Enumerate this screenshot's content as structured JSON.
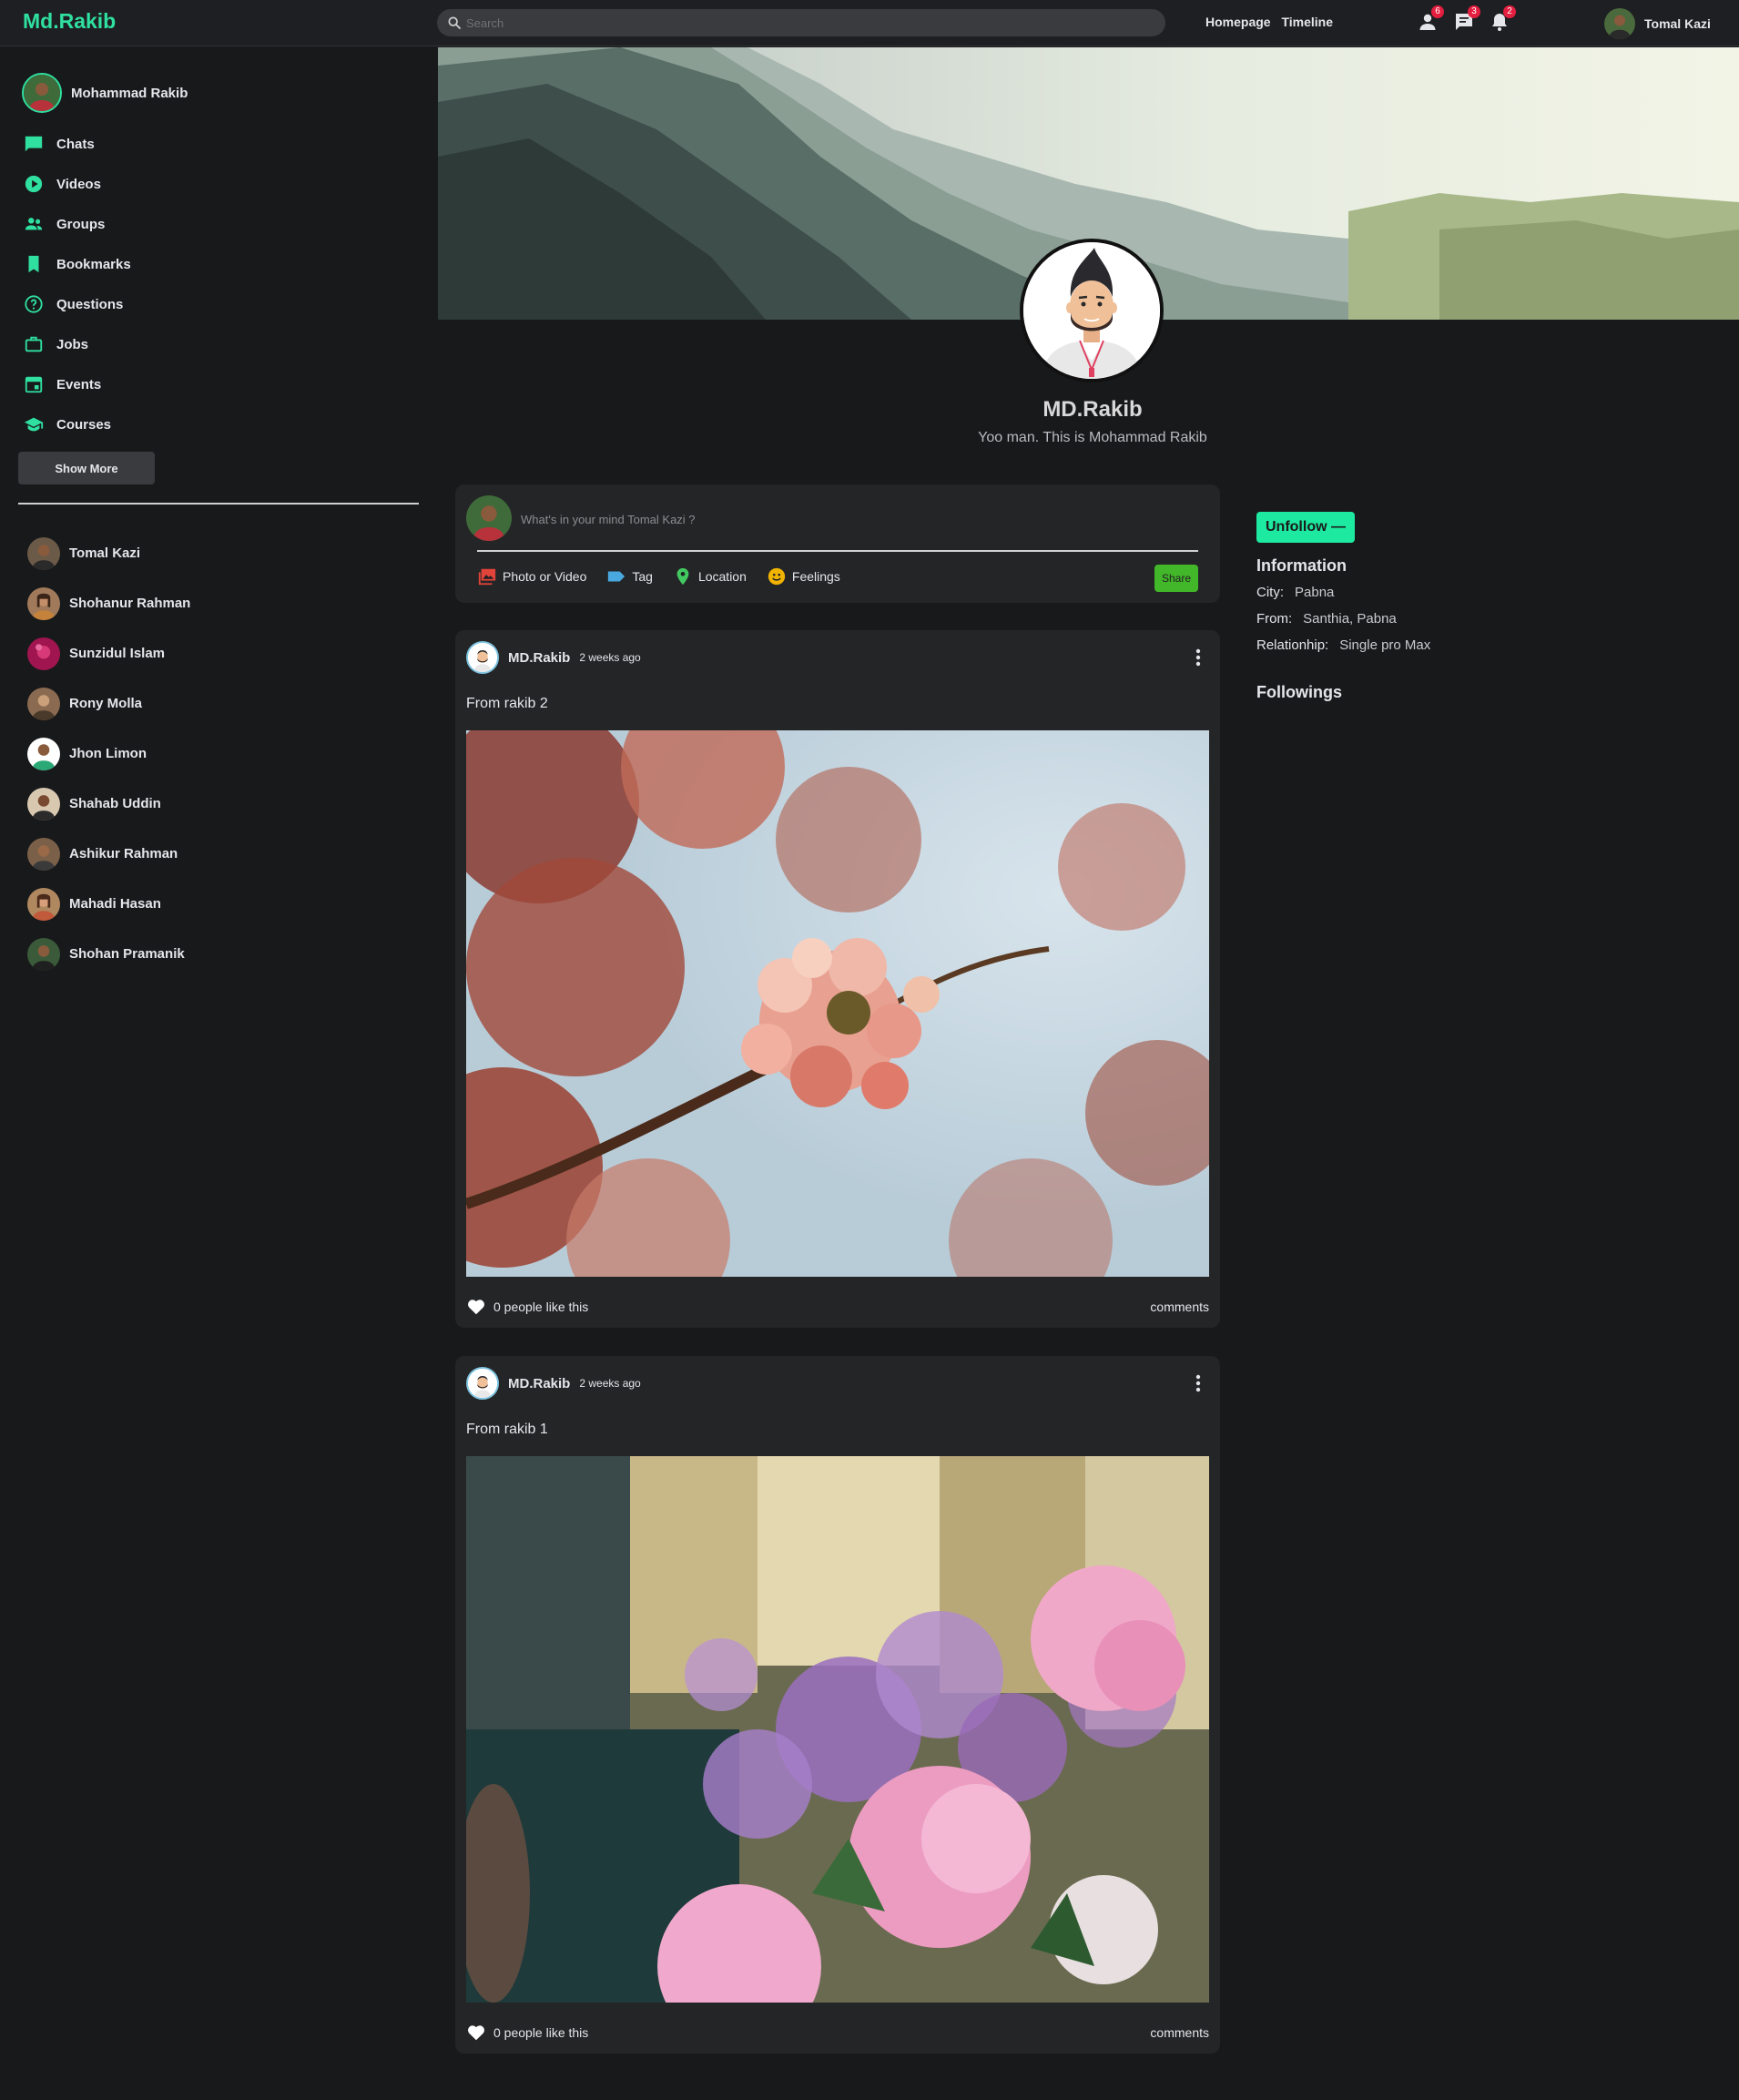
{
  "colors": {
    "accent": "#2fe0a0",
    "badge": "#e41e3f",
    "share_button": "#42b72a",
    "unfollow_button": "#1de9a0"
  },
  "topbar": {
    "logo": "Md.Rakib",
    "search_placeholder": "Search",
    "links": [
      "Homepage",
      "Timeline"
    ],
    "badges": {
      "friends": "6",
      "messages": "3",
      "notifications": "2"
    },
    "user_name": "Tomal Kazi"
  },
  "sidebar": {
    "me": "Mohammad Rakib",
    "items": [
      {
        "label": "Chats",
        "icon": "chat-icon"
      },
      {
        "label": "Videos",
        "icon": "play-circle-icon"
      },
      {
        "label": "Groups",
        "icon": "groups-icon"
      },
      {
        "label": "Bookmarks",
        "icon": "bookmark-icon"
      },
      {
        "label": "Questions",
        "icon": "help-circle-icon"
      },
      {
        "label": "Jobs",
        "icon": "briefcase-icon"
      },
      {
        "label": "Events",
        "icon": "calendar-icon"
      },
      {
        "label": "Courses",
        "icon": "school-icon"
      }
    ],
    "show_more": "Show More",
    "friends": [
      "Tomal Kazi",
      "Shohanur Rahman",
      "Sunzidul Islam",
      "Rony Molla",
      "Jhon Limon",
      "Shahab Uddin",
      "Ashikur Rahman",
      "Mahadi Hasan",
      "Shohan Pramanik"
    ]
  },
  "profile": {
    "name": "MD.Rakib",
    "bio": "Yoo man. This is Mohammad Rakib"
  },
  "share": {
    "placeholder": "What's in your mind Tomal Kazi ?",
    "options": [
      "Photo or Video",
      "Tag",
      "Location",
      "Feelings"
    ],
    "button": "Share"
  },
  "posts": [
    {
      "author": "MD.Rakib",
      "time": "2 weeks ago",
      "text": "From rakib 2",
      "likes": "0 people like this",
      "comments": "comments"
    },
    {
      "author": "MD.Rakib",
      "time": "2 weeks ago",
      "text": "From rakib 1",
      "likes": "0 people like this",
      "comments": "comments"
    }
  ],
  "right": {
    "unfollow": "Unfollow",
    "info_title": "Information",
    "city_label": "City:",
    "city": "Pabna",
    "from_label": "From:",
    "from": "Santhia, Pabna",
    "relationship_label": "Relationhip:",
    "relationship": "Single pro Max",
    "followings_title": "Followings"
  }
}
